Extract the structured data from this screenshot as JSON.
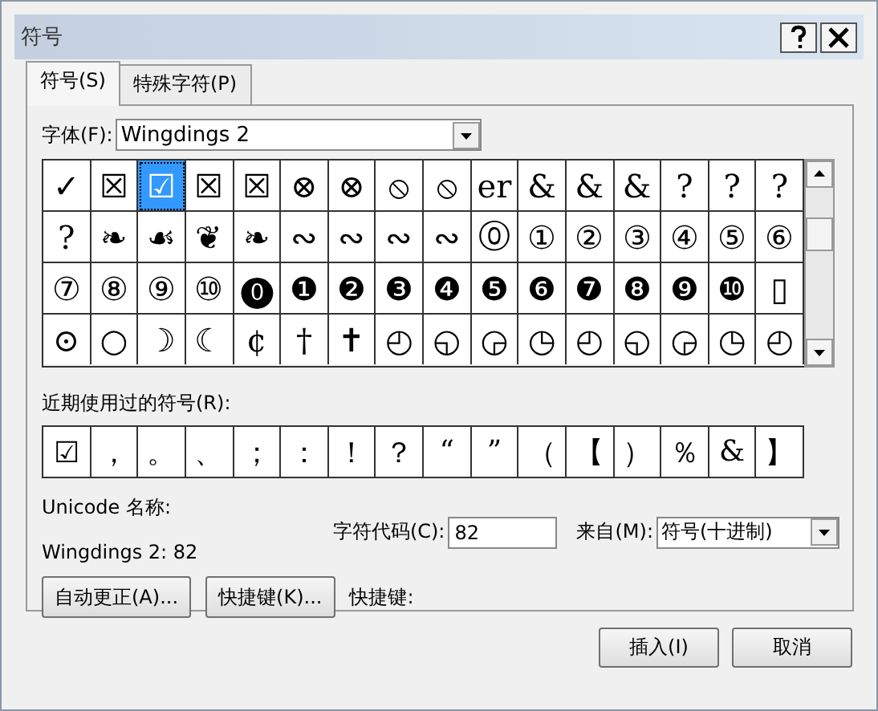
{
  "window": {
    "title": "符号"
  },
  "tabs": [
    {
      "label": "符号(S)",
      "selected": true
    },
    {
      "label": "特殊字符(P)",
      "selected": false
    }
  ],
  "font": {
    "label": "字体(F):",
    "value": "Wingdings 2"
  },
  "symbols": [
    {
      "cells": [
        {
          "s": "✓",
          "selected": false
        },
        {
          "s": "☒",
          "selected": false
        },
        {
          "s": "☑",
          "selected": true
        },
        {
          "s": "☒",
          "selected": false
        },
        {
          "s": "☒",
          "selected": false
        },
        {
          "s": "⊗",
          "selected": false
        },
        {
          "s": "⊗",
          "selected": false
        },
        {
          "s": "⦸",
          "selected": false
        },
        {
          "s": "⦸",
          "selected": false
        },
        {
          "s": "er",
          "selected": false
        },
        {
          "s": "&",
          "selected": false
        },
        {
          "s": "&",
          "selected": false
        },
        {
          "s": "&",
          "selected": false
        },
        {
          "s": "?",
          "selected": false
        },
        {
          "s": "?",
          "selected": false
        },
        {
          "s": "?",
          "selected": false
        }
      ]
    },
    {
      "cells": [
        {
          "s": "?",
          "selected": false
        },
        {
          "s": "❧",
          "selected": false
        },
        {
          "s": "☙",
          "selected": false
        },
        {
          "s": "❦",
          "selected": false
        },
        {
          "s": "❧",
          "selected": false
        },
        {
          "s": "∾",
          "selected": false
        },
        {
          "s": "∾",
          "selected": false
        },
        {
          "s": "∾",
          "selected": false
        },
        {
          "s": "∾",
          "selected": false
        },
        {
          "s": "⓪",
          "selected": false
        },
        {
          "s": "①",
          "selected": false
        },
        {
          "s": "②",
          "selected": false
        },
        {
          "s": "③",
          "selected": false
        },
        {
          "s": "④",
          "selected": false
        },
        {
          "s": "⑤",
          "selected": false
        },
        {
          "s": "⑥",
          "selected": false
        }
      ]
    },
    {
      "cells": [
        {
          "s": "⑦",
          "selected": false
        },
        {
          "s": "⑧",
          "selected": false
        },
        {
          "s": "⑨",
          "selected": false
        },
        {
          "s": "⑩",
          "selected": false
        },
        {
          "s": "⓿",
          "selected": false
        },
        {
          "s": "❶",
          "selected": false
        },
        {
          "s": "❷",
          "selected": false
        },
        {
          "s": "❸",
          "selected": false
        },
        {
          "s": "❹",
          "selected": false
        },
        {
          "s": "❺",
          "selected": false
        },
        {
          "s": "❻",
          "selected": false
        },
        {
          "s": "❼",
          "selected": false
        },
        {
          "s": "❽",
          "selected": false
        },
        {
          "s": "❾",
          "selected": false
        },
        {
          "s": "❿",
          "selected": false
        },
        {
          "s": "▯",
          "selected": false
        }
      ]
    },
    {
      "cells": [
        {
          "s": "⊙",
          "selected": false
        },
        {
          "s": "○",
          "selected": false
        },
        {
          "s": "☽",
          "selected": false
        },
        {
          "s": "☾",
          "selected": false
        },
        {
          "s": "¢",
          "selected": false
        },
        {
          "s": "†",
          "selected": false
        },
        {
          "s": "✝",
          "selected": false
        },
        {
          "s": "◴",
          "selected": false
        },
        {
          "s": "◵",
          "selected": false
        },
        {
          "s": "◶",
          "selected": false
        },
        {
          "s": "◷",
          "selected": false
        },
        {
          "s": "◴",
          "selected": false
        },
        {
          "s": "◵",
          "selected": false
        },
        {
          "s": "◶",
          "selected": false
        },
        {
          "s": "◷",
          "selected": false
        },
        {
          "s": "◴",
          "selected": false
        }
      ]
    }
  ],
  "recent": {
    "label": "近期使用过的符号(R):",
    "symbols": [
      "☑",
      "，",
      "。",
      "、",
      "；",
      "：",
      "！",
      "？",
      "“",
      "”",
      "（",
      "【",
      "）",
      "％",
      "&",
      "】"
    ]
  },
  "unicode_name": {
    "label": "Unicode 名称:",
    "value": "Wingdings 2: 82"
  },
  "char_code": {
    "label": "字符代码(C):",
    "value": "82"
  },
  "from": {
    "label": "来自(M):",
    "value": "符号(十进制)"
  },
  "buttons": [
    "自动更正(A)...",
    "快捷键(K)..."
  ],
  "shortcut": {
    "label": "快捷键:"
  },
  "actions": [
    "插入(I)",
    "取消"
  ]
}
